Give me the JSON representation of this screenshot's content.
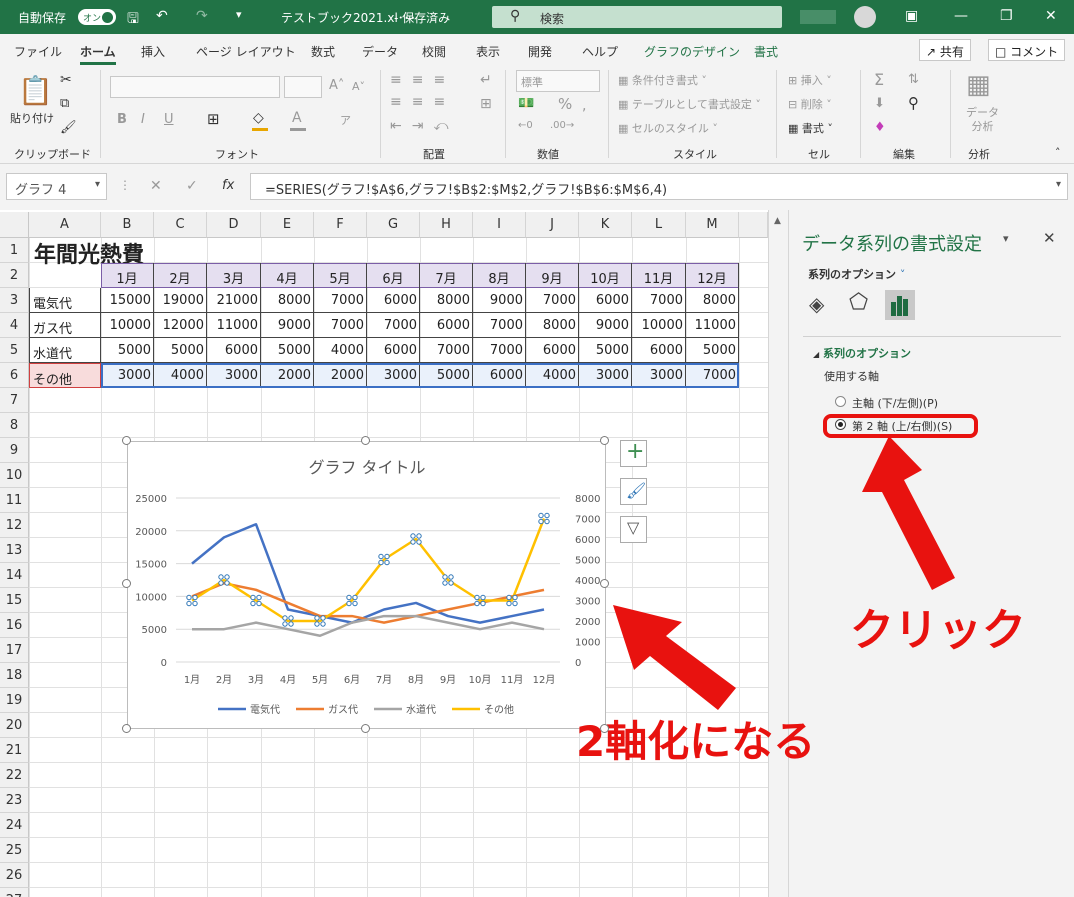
{
  "titlebar": {
    "autosave": "自動保存",
    "autosave_state": "オン",
    "filename": "テストブック2021.xl･･･",
    "saved": "- 保存済み",
    "search": "検索"
  },
  "tabs": [
    "ファイル",
    "ホーム",
    "挿入",
    "ページ レイアウト",
    "数式",
    "データ",
    "校閲",
    "表示",
    "開発",
    "ヘルプ",
    "グラフのデザイン",
    "書式"
  ],
  "share": "共有",
  "comment": "コメント",
  "ribbon": {
    "paste": "貼り付け",
    "clipboard": "クリップボード",
    "font": "フォント",
    "align": "配置",
    "number": "数値",
    "number_format": "標準",
    "style": "スタイル",
    "style_items": [
      "条件付き書式",
      "テーブルとして書式設定",
      "セルのスタイル"
    ],
    "cells": "セル",
    "cell_items": [
      "挿入",
      "削除",
      "書式"
    ],
    "edit": "編集",
    "analysis": "分析",
    "analyze_btn": "データ\n分析"
  },
  "namebox": "グラフ 4",
  "formula": "=SERIES(グラフ!$A$6,グラフ!$B$2:$M$2,グラフ!$B$6:$M$6,4)",
  "columns": [
    "A",
    "B",
    "C",
    "D",
    "E",
    "F",
    "G",
    "H",
    "I",
    "J",
    "K",
    "L",
    "M"
  ],
  "sheet": {
    "title": "年間光熱費",
    "months": [
      "1月",
      "2月",
      "3月",
      "4月",
      "5月",
      "6月",
      "7月",
      "8月",
      "9月",
      "10月",
      "11月",
      "12月"
    ],
    "rows": [
      {
        "label": "電気代",
        "values": [
          15000,
          19000,
          21000,
          8000,
          7000,
          6000,
          8000,
          9000,
          7000,
          6000,
          7000,
          8000
        ]
      },
      {
        "label": "ガス代",
        "values": [
          10000,
          12000,
          11000,
          9000,
          7000,
          7000,
          6000,
          7000,
          8000,
          9000,
          10000,
          11000
        ]
      },
      {
        "label": "水道代",
        "values": [
          5000,
          5000,
          6000,
          5000,
          4000,
          6000,
          7000,
          7000,
          6000,
          5000,
          6000,
          5000
        ]
      },
      {
        "label": "その他",
        "values": [
          3000,
          4000,
          3000,
          2000,
          2000,
          3000,
          5000,
          6000,
          4000,
          3000,
          3000,
          7000
        ]
      }
    ]
  },
  "chart_data": {
    "type": "line",
    "title": "グラフ タイトル",
    "categories": [
      "1月",
      "2月",
      "3月",
      "4月",
      "5月",
      "6月",
      "7月",
      "8月",
      "9月",
      "10月",
      "11月",
      "12月"
    ],
    "series": [
      {
        "name": "電気代",
        "color": "#4472c4",
        "axis": "primary",
        "values": [
          15000,
          19000,
          21000,
          8000,
          7000,
          6000,
          8000,
          9000,
          7000,
          6000,
          7000,
          8000
        ]
      },
      {
        "name": "ガス代",
        "color": "#ed7d31",
        "axis": "primary",
        "values": [
          10000,
          12000,
          11000,
          9000,
          7000,
          7000,
          6000,
          7000,
          8000,
          9000,
          10000,
          11000
        ]
      },
      {
        "name": "水道代",
        "color": "#a5a5a5",
        "axis": "primary",
        "values": [
          5000,
          5000,
          6000,
          5000,
          4000,
          6000,
          7000,
          7000,
          6000,
          5000,
          6000,
          5000
        ]
      },
      {
        "name": "その他",
        "color": "#ffc000",
        "axis": "secondary",
        "values": [
          3000,
          4000,
          3000,
          2000,
          2000,
          3000,
          5000,
          6000,
          4000,
          3000,
          3000,
          7000
        ]
      }
    ],
    "ylim": [
      0,
      25000
    ],
    "yticks": [
      "25000",
      "20000",
      "15000",
      "10000",
      "5000",
      "0"
    ],
    "y2lim": [
      0,
      8000
    ],
    "y2ticks": [
      "8000",
      "7000",
      "6000",
      "5000",
      "4000",
      "3000",
      "2000",
      "1000",
      "0"
    ],
    "legend": "bottom",
    "grid": true
  },
  "panel": {
    "title": "データ系列の書式設定",
    "options": "系列のオプション",
    "section": "系列のオプション",
    "use_axis": "使用する軸",
    "primary": "主軸 (下/左側)(P)",
    "secondary": "第 2 軸 (上/右側)(S)"
  },
  "annotations": {
    "click": "クリック",
    "two_axis": "2軸化になる"
  }
}
